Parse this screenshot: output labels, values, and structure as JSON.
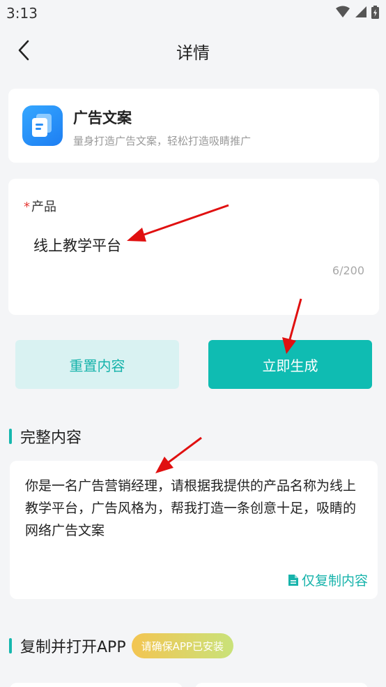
{
  "status_bar": {
    "time": "3:13"
  },
  "nav": {
    "title": "详情"
  },
  "app": {
    "name": "广告文案",
    "description": "量身打造广告文案，轻松打造吸睛推广"
  },
  "form": {
    "label": "产品",
    "required_mark": "*",
    "value": "线上教学平台",
    "count": "6/200"
  },
  "buttons": {
    "reset": "重置内容",
    "generate": "立即生成"
  },
  "full_content": {
    "title": "完整内容",
    "text": "你是一名广告营销经理，请根据我提供的产品名称为线上教学平台，广告风格为，帮我打造一条创意十足，吸睛的网络广告文案",
    "copy_label": "仅复制内容"
  },
  "copy_open": {
    "title": "复制并打开APP",
    "badge": "请确保APP已安装"
  },
  "colors": {
    "accent": "#0fbcb2",
    "accent_light": "#d9f2f2",
    "annotation_arrow": "#e01010"
  },
  "icons": [
    "wifi-icon",
    "signal-icon",
    "battery-icon",
    "back-arrow-icon",
    "document-icon",
    "copy-file-icon"
  ]
}
